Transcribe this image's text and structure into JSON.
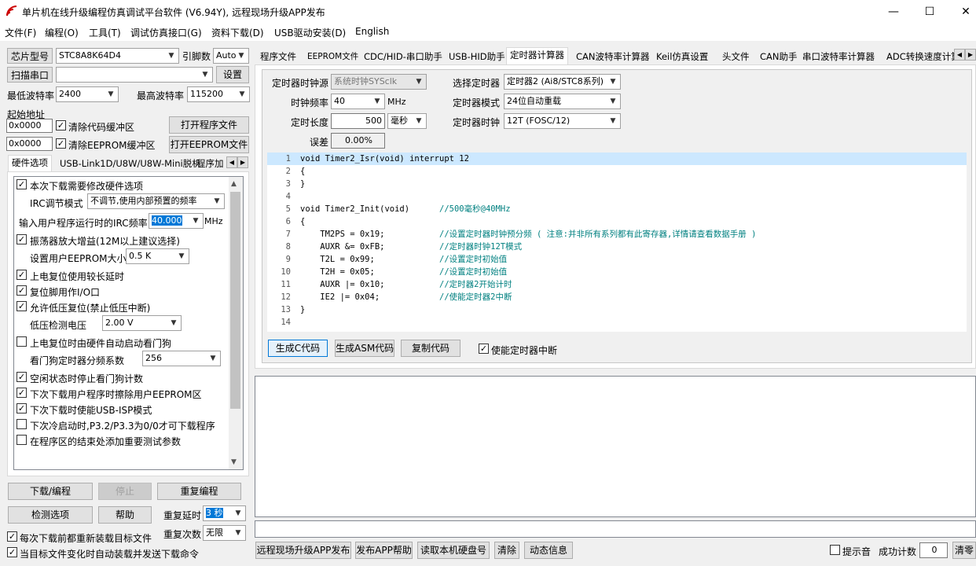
{
  "window": {
    "title": "单片机在线升级编程仿真调试平台软件 (V6.94Y), 远程现场升级APP发布"
  },
  "menu": [
    "文件(F)",
    "编程(O)",
    "工具(T)",
    "调试仿真接口(G)",
    "资料下载(D)",
    "USB驱动安装(D)",
    "English"
  ],
  "left": {
    "chip_label": "芯片型号",
    "chip_value": "STC8A8K64D4",
    "pin_label": "引脚数",
    "pin_value": "Auto",
    "scan_label": "扫描串口",
    "port_value": "",
    "settings_label": "设置",
    "min_baud_label": "最低波特率",
    "min_baud": "2400",
    "max_baud_label": "最高波特率",
    "max_baud": "115200",
    "start_addr_label": "起始地址",
    "addr1": "0x0000",
    "clear_code": "清除代码缓冲区",
    "open_prog": "打开程序文件",
    "addr2": "0x0000",
    "clear_eeprom": "清除EEPROM缓冲区",
    "open_eeprom": "打开EEPROM文件",
    "tabs": [
      "硬件选项",
      "USB-Link1D/U8W/U8W-Mini脱机",
      "程序加"
    ],
    "options": {
      "o1": "本次下载需要修改硬件选项",
      "irc_mode_label": "IRC调节模式",
      "irc_mode": "不调节,使用内部预置的频率",
      "irc_freq_label": "输入用户程序运行时的IRC频率",
      "irc_freq": "40.000",
      "irc_unit": "MHz",
      "o2": "振荡器放大增益(12M以上建议选择)",
      "eeprom_size_label": "设置用户EEPROM大小",
      "eeprom_size": "0.5 K",
      "o3": "上电复位使用较长延时",
      "o4": "复位脚用作I/O口",
      "o5": "允许低压复位(禁止低压中断)",
      "lv_label": "低压检测电压",
      "lv_value": "2.00 V",
      "o6": "上电复位时由硬件自动启动看门狗",
      "wdt_label": "看门狗定时器分频系数",
      "wdt_value": "256",
      "o7": "空闲状态时停止看门狗计数",
      "o8": "下次下载用户程序时擦除用户EEPROM区",
      "o9": "下次下载时使能USB-ISP模式",
      "o10": "下次冷启动时,P3.2/P3.3为0/0才可下载程序",
      "o11": "在程序区的结束处添加重要测试参数"
    },
    "download": "下载/编程",
    "stop": "停止",
    "reprogram": "重复编程",
    "check": "检测选项",
    "help": "帮助",
    "repeat_delay_label": "重复延时",
    "repeat_delay": "3 秒",
    "repeat_count_label": "重复次数",
    "repeat_count": "无限",
    "reload_each": "每次下载前都重新装载目标文件",
    "auto_reload": "当目标文件变化时自动装载并发送下载命令"
  },
  "right": {
    "tabs": [
      "程序文件",
      "EEPROM文件",
      "CDC/HID-串口助手",
      "USB-HID助手",
      "定时器计算器",
      "CAN波特率计算器",
      "Keil仿真设置",
      "头文件",
      "CAN助手",
      "串口波特率计算器",
      "ADC转换速度计算"
    ],
    "clock_src_label": "定时器时钟源",
    "clock_src": "系统时钟SYSclk",
    "select_timer_label": "选择定时器",
    "select_timer": "定时器2 (Ai8/STC8系列)",
    "clock_freq_label": "时钟频率",
    "clock_freq": "40",
    "mhz": "MHz",
    "timer_mode_label": "定时器模式",
    "timer_mode": "24位自动重载",
    "timer_len_label": "定时长度",
    "timer_len": "500",
    "timer_unit": "毫秒",
    "timer_clk_label": "定时器时钟",
    "timer_clk": "12T (FOSC/12)",
    "error_label": "误差",
    "error_value": "0.00%",
    "code_lines": [
      {
        "n": "1",
        "t": "void Timer2_Isr(void) interrupt 12",
        "c": ""
      },
      {
        "n": "2",
        "t": "{",
        "c": ""
      },
      {
        "n": "3",
        "t": "}",
        "c": ""
      },
      {
        "n": "4",
        "t": "",
        "c": ""
      },
      {
        "n": "5",
        "t": "void Timer2_Init(void)      ",
        "c": "//500毫秒@40MHz"
      },
      {
        "n": "6",
        "t": "{",
        "c": ""
      },
      {
        "n": "7",
        "t": "    TM2PS = 0x19;           ",
        "c": "//设置定时器时钟预分频 ( 注意:并非所有系列都有此寄存器,详情请查看数据手册 )"
      },
      {
        "n": "8",
        "t": "    AUXR &= 0xFB;           ",
        "c": "//定时器时钟12T模式"
      },
      {
        "n": "9",
        "t": "    T2L = 0x99;             ",
        "c": "//设置定时初始值"
      },
      {
        "n": "10",
        "t": "    T2H = 0x05;             ",
        "c": "//设置定时初始值"
      },
      {
        "n": "11",
        "t": "    AUXR |= 0x10;           ",
        "c": "//定时器2开始计时"
      },
      {
        "n": "12",
        "t": "    IE2 |= 0x04;            ",
        "c": "//使能定时器2中断"
      },
      {
        "n": "13",
        "t": "}",
        "c": ""
      },
      {
        "n": "14",
        "t": "",
        "c": ""
      }
    ],
    "gen_c": "生成C代码",
    "gen_asm": "生成ASM代码",
    "copy_code": "复制代码",
    "enable_int": "使能定时器中断",
    "remote_publish": "远程现场升级APP发布",
    "publish_help": "发布APP帮助",
    "read_disk": "读取本机硬盘号",
    "clear": "清除",
    "dynamic_info": "动态信息",
    "beep": "提示音",
    "success_count_label": "成功计数",
    "success_count": "0",
    "reset_count": "清零"
  }
}
